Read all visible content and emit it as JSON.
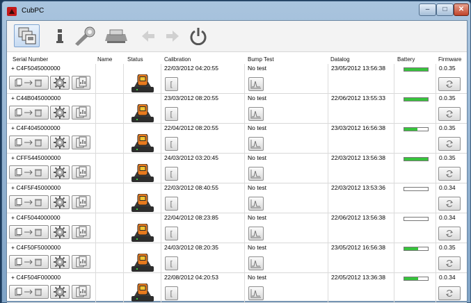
{
  "window": {
    "title": "CubPC"
  },
  "toolbar": {
    "buttons": [
      {
        "name": "devices",
        "icon": "devices-icon"
      },
      {
        "name": "info",
        "icon": "info-icon"
      },
      {
        "name": "settings",
        "icon": "wrench-gear-icon"
      },
      {
        "name": "print",
        "icon": "printer-icon"
      },
      {
        "name": "back",
        "icon": "arrow-left-icon"
      },
      {
        "name": "forward",
        "icon": "arrow-right-icon"
      },
      {
        "name": "power",
        "icon": "power-icon"
      }
    ]
  },
  "columns": {
    "serial": "Serial Number",
    "name": "Name",
    "status": "Status",
    "calibration": "Calibration",
    "bump": "Bump Test",
    "datalog": "Datalog",
    "battery": "Battery",
    "firmware": "Firmware"
  },
  "rows": [
    {
      "serial": "+ C4F5045000000",
      "name": "",
      "calibration": "22/03/2012 04:20:55",
      "bump": "No test",
      "datalog": "23/05/2012 13:56:38",
      "battery": 1.0,
      "firmware": "0.0.35"
    },
    {
      "serial": "+ C44B045000000",
      "name": "",
      "calibration": "23/03/2012 08:20:55",
      "bump": "No test",
      "datalog": "22/06/2012 13:55:33",
      "battery": 1.0,
      "firmware": "0.0.35"
    },
    {
      "serial": "+ C4F4045000000",
      "name": "",
      "calibration": "22/04/2012 08:20:55",
      "bump": "No test",
      "datalog": "23/03/2012 16:56:38",
      "battery": 0.55,
      "firmware": "0.0.35"
    },
    {
      "serial": "+ CFF5445000000",
      "name": "",
      "calibration": "24/03/2012 03:20:45",
      "bump": "No test",
      "datalog": "22/03/2012 13:56:38",
      "battery": 1.0,
      "firmware": "0.0.35"
    },
    {
      "serial": "+ C4F5F45000000",
      "name": "",
      "calibration": "22/03/2012 08:40:55",
      "bump": "No test",
      "datalog": "22/03/2012 13:53:36",
      "battery": 0.0,
      "firmware": "0.0.34"
    },
    {
      "serial": "+ C4F5044000000",
      "name": "",
      "calibration": "22/04/2012 08:23:85",
      "bump": "No test",
      "datalog": "22/06/2012 13:56:38",
      "battery": 0.0,
      "firmware": "0.0.34"
    },
    {
      "serial": "+ C4F50F5000000",
      "name": "",
      "calibration": "24/03/2012 08:20:35",
      "bump": "No test",
      "datalog": "23/05/2012 16:56:38",
      "battery": 0.6,
      "firmware": "0.0.35"
    },
    {
      "serial": "+ C4F504F000000",
      "name": "",
      "calibration": "22/08/2012 04:20:53",
      "bump": "No test",
      "datalog": "22/05/2012 13:36:38",
      "battery": 0.6,
      "firmware": "0.0.34"
    }
  ],
  "colors": {
    "battery_fill": "#37c33c",
    "accent": "#3366aa"
  }
}
